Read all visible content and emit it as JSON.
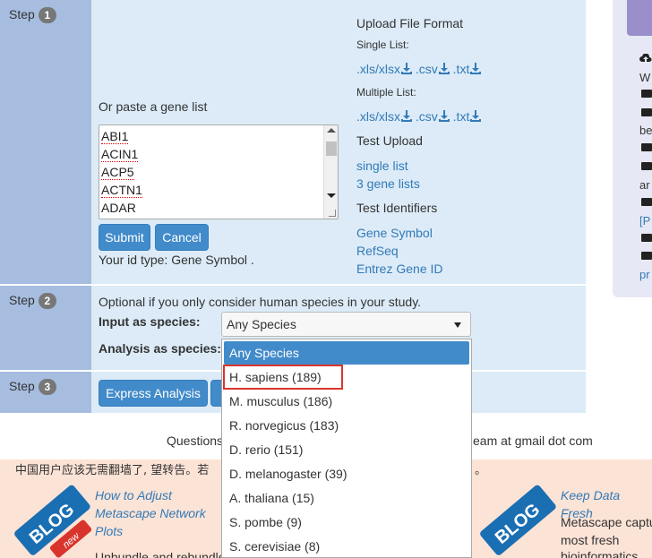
{
  "step1": {
    "label": "Step",
    "num": "1",
    "paste_label": "Or paste a gene list",
    "gene_list": [
      "ABI1",
      "ACIN1",
      "ACP5",
      "ACTN1",
      "ADAR"
    ],
    "submit": "Submit",
    "cancel": "Cancel",
    "id_type": "Your id type: Gene Symbol ."
  },
  "upload_format": {
    "title": "Upload File Format",
    "single_list": "Single List:",
    "multiple_list": "Multiple List:",
    "formats": [
      ".xls/xlsx",
      ".csv",
      ".txt"
    ]
  },
  "test_upload": {
    "title": "Test Upload",
    "links": [
      "single list",
      "3 gene lists"
    ]
  },
  "test_identifiers": {
    "title": "Test Identifiers",
    "links": [
      "Gene Symbol",
      "RefSeq",
      "Entrez Gene ID"
    ]
  },
  "step2": {
    "label": "Step",
    "num": "2",
    "optional": "Optional if you only consider human species in your study.",
    "input_species_label": "Input as species:",
    "analysis_species_label": "Analysis as species:",
    "selected_species": "Any Species",
    "options": [
      "Any Species",
      "H. sapiens (189)",
      "M. musculus (186)",
      "R. norvegicus (183)",
      "D. rerio (151)",
      "D. melanogaster (39)",
      "A. thaliana (15)",
      "S. pombe (9)",
      "S. cerevisiae (8)"
    ]
  },
  "step3": {
    "label": "Step",
    "num": "3",
    "express_analysis": "Express Analysis"
  },
  "footer": {
    "questions": "Questions",
    "contact_tail": "eam at gmail dot com",
    "chinese_notice": "中国用户应该无需翻墙了, 望转告。若",
    "chinese_tail": "。"
  },
  "blog": {
    "left_link": [
      "How to Adjust",
      "Metascape Network",
      "Plots"
    ],
    "left_text": "Unbundle and rebundle",
    "right_link": "Keep Data Fresh",
    "right_text": [
      "Metascape captu",
      "most fresh",
      "bioinformatics"
    ],
    "badge_text": "BLOG",
    "badge_new": "new"
  },
  "side_panel": {
    "items": [
      "W",
      "be",
      "ar",
      "[P",
      "pr"
    ]
  },
  "colors": {
    "step_col": "#a7bde0",
    "content_bg": "#dcebf7",
    "button": "#428bca",
    "link": "#337ab7",
    "highlight_box": "#d9342b"
  }
}
